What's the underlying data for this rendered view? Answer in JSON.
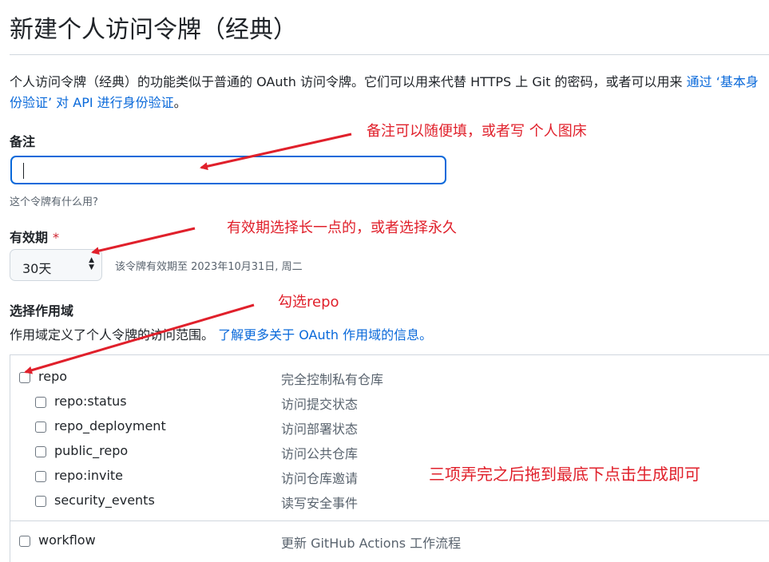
{
  "page": {
    "title": "新建个人访问令牌（经典）",
    "intro_text": "个人访问令牌（经典）的功能类似于普通的 OAuth 访问令牌。它们可以用来代替 HTTPS 上 Git 的密码，或者可以用来 ",
    "intro_link": "通过 ‘基本身份验证’ 对 API 进行身份验证",
    "intro_end": "。"
  },
  "note": {
    "label": "备注",
    "value": "",
    "hint": "这个令牌有什么用?"
  },
  "expiration": {
    "label": "有效期",
    "required_mark": "*",
    "selected": "30天",
    "hint": "该令牌有效期至 2023年10月31日, 周二"
  },
  "scopes": {
    "heading": "选择作用域",
    "description": "作用域定义了个人令牌的访问范围。",
    "learn_more": "了解更多关于 OAuth 作用域的信息。",
    "items": [
      {
        "name": "repo",
        "desc": "完全控制私有仓库",
        "checked": false
      },
      {
        "name": "repo:status",
        "desc": "访问提交状态",
        "checked": false
      },
      {
        "name": "repo_deployment",
        "desc": "访问部署状态",
        "checked": false
      },
      {
        "name": "public_repo",
        "desc": "访问公共仓库",
        "checked": false
      },
      {
        "name": "repo:invite",
        "desc": "访问仓库邀请",
        "checked": false
      },
      {
        "name": "security_events",
        "desc": "读写安全事件",
        "checked": false
      },
      {
        "name": "workflow",
        "desc": "更新 GitHub Actions 工作流程",
        "checked": false
      }
    ]
  },
  "annotations": {
    "note_tip": "备注可以随便填，或者写 个人图床",
    "expiration_tip": "有效期选择长一点的，或者选择永久",
    "repo_tip": "勾选repo",
    "final_tip": "三项弄完之后拖到最底下点击生成即可",
    "color": "#e0202b"
  },
  "colors": {
    "link": "#0969da",
    "focus_border": "#0969da",
    "required": "#cf222e",
    "muted": "#59636e",
    "border": "#d0d7de"
  }
}
